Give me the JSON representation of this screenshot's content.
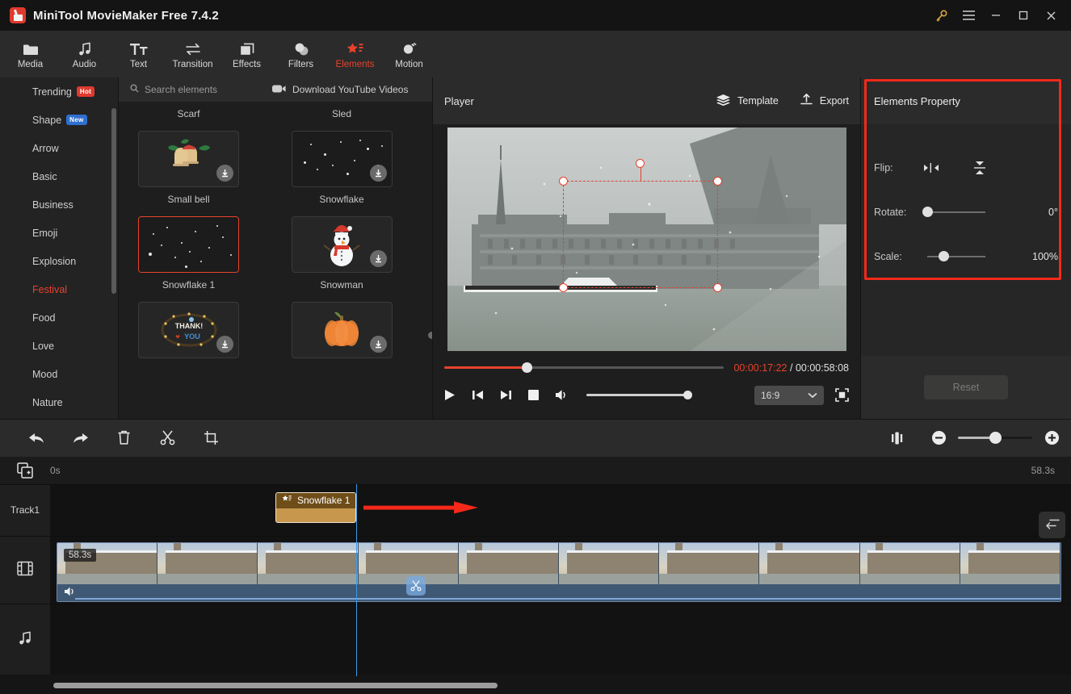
{
  "titlebar": {
    "app_title": "MiniTool MovieMaker Free 7.4.2",
    "logo_name": "minitool-logo",
    "buttons": [
      {
        "name": "key-icon",
        "label": "Activate"
      },
      {
        "name": "menu-icon",
        "label": "Menu"
      },
      {
        "name": "minimize-icon",
        "label": "Minimize"
      },
      {
        "name": "maximize-icon",
        "label": "Maximize"
      },
      {
        "name": "close-icon",
        "label": "Close"
      }
    ]
  },
  "toolbar": {
    "active": "Elements",
    "items": [
      {
        "label": "Media",
        "icon": "folder-icon"
      },
      {
        "label": "Audio",
        "icon": "music-note-icon"
      },
      {
        "label": "Text",
        "icon": "text-icon"
      },
      {
        "label": "Transition",
        "icon": "transition-arrows-icon"
      },
      {
        "label": "Effects",
        "icon": "layers-square-icon"
      },
      {
        "label": "Filters",
        "icon": "circles-overlap-icon"
      },
      {
        "label": "Elements",
        "icon": "star-sparkle-icon"
      },
      {
        "label": "Motion",
        "icon": "motion-blur-circle-icon"
      }
    ]
  },
  "library": {
    "categories": [
      {
        "label": "Trending",
        "badge": "Hot",
        "badge_type": "hot",
        "active": false
      },
      {
        "label": "Shape",
        "badge": "New",
        "badge_type": "new",
        "active": false
      },
      {
        "label": "Arrow",
        "badge": "",
        "active": false
      },
      {
        "label": "Basic",
        "badge": "",
        "active": false
      },
      {
        "label": "Business",
        "badge": "",
        "active": false
      },
      {
        "label": "Emoji",
        "badge": "",
        "active": false
      },
      {
        "label": "Explosion",
        "badge": "",
        "active": false
      },
      {
        "label": "Festival",
        "badge": "",
        "active": true
      },
      {
        "label": "Food",
        "badge": "",
        "active": false
      },
      {
        "label": "Love",
        "badge": "",
        "active": false
      },
      {
        "label": "Mood",
        "badge": "",
        "active": false
      },
      {
        "label": "Nature",
        "badge": "",
        "active": false
      }
    ],
    "search_placeholder": "Search elements",
    "youtube_label": "Download YouTube Videos",
    "items": [
      {
        "label": "Scarf",
        "selected": false,
        "downloadable": true,
        "kind": "partial"
      },
      {
        "label": "Sled",
        "selected": false,
        "downloadable": true,
        "kind": "partial"
      },
      {
        "label": "Small bell",
        "selected": false,
        "downloadable": true,
        "kind": "bell"
      },
      {
        "label": "Snowflake",
        "selected": false,
        "downloadable": true,
        "kind": "snow"
      },
      {
        "label": "Snowflake 1",
        "selected": true,
        "downloadable": false,
        "kind": "snow"
      },
      {
        "label": "Snowman",
        "selected": false,
        "downloadable": true,
        "kind": "snowman"
      },
      {
        "label": "",
        "selected": false,
        "downloadable": true,
        "kind": "thanks"
      },
      {
        "label": "",
        "selected": false,
        "downloadable": true,
        "kind": "pumpkin"
      }
    ]
  },
  "player": {
    "title": "Player",
    "template_label": "Template",
    "export_label": "Export",
    "current_time": "00:00:17:22",
    "separator": "/",
    "total_time": "00:00:58:08",
    "aspect_ratio": "16:9",
    "seek_percent": 29.5,
    "controls": [
      {
        "name": "play-button",
        "label": "Play"
      },
      {
        "name": "previous-frame-button",
        "label": "Previous"
      },
      {
        "name": "next-frame-button",
        "label": "Next"
      },
      {
        "name": "stop-button",
        "label": "Stop"
      },
      {
        "name": "volume-icon",
        "label": "Volume"
      }
    ]
  },
  "properties": {
    "title": "Elements Property",
    "flip_label": "Flip:",
    "flip_horizontal": "flip-horizontal-icon",
    "flip_vertical": "flip-vertical-icon",
    "rotate_label": "Rotate:",
    "rotate_value": "0°",
    "rotate_percent": 0,
    "scale_label": "Scale:",
    "scale_value": "100%",
    "scale_percent": 28,
    "reset_label": "Reset",
    "highlight_color": "#f4291a"
  },
  "timeline": {
    "tools": [
      {
        "name": "undo-button",
        "label": "Undo"
      },
      {
        "name": "redo-button",
        "label": "Redo"
      },
      {
        "name": "delete-button",
        "label": "Delete"
      },
      {
        "name": "split-button",
        "label": "Split"
      },
      {
        "name": "crop-button",
        "label": "Crop"
      }
    ],
    "fit-label": "Fit to timeline",
    "zoom_out": "−",
    "zoom_in": "+",
    "start_time": "0s",
    "end_time": "58.3s",
    "add_track_icon": "add-media-icon",
    "tracks": [
      {
        "name": "Track1",
        "icon": "",
        "label": "Track1"
      },
      {
        "name": "video-track",
        "icon": "film-icon",
        "label": ""
      },
      {
        "name": "audio-track",
        "icon": "music-note-icon",
        "label": ""
      }
    ],
    "element_clip": {
      "label": "Snowflake 1",
      "icon": "element-star-icon"
    },
    "video_clip": {
      "duration": "58.3s"
    },
    "annotation_arrow": "red-drag-arrow"
  },
  "colors": {
    "accent": "#e8422c",
    "highlight": "#f4291a",
    "clip": "#c7974e",
    "playhead": "#3e9ae8",
    "badge_hot": "#e03a2f",
    "badge_new": "#2f6fd0"
  }
}
